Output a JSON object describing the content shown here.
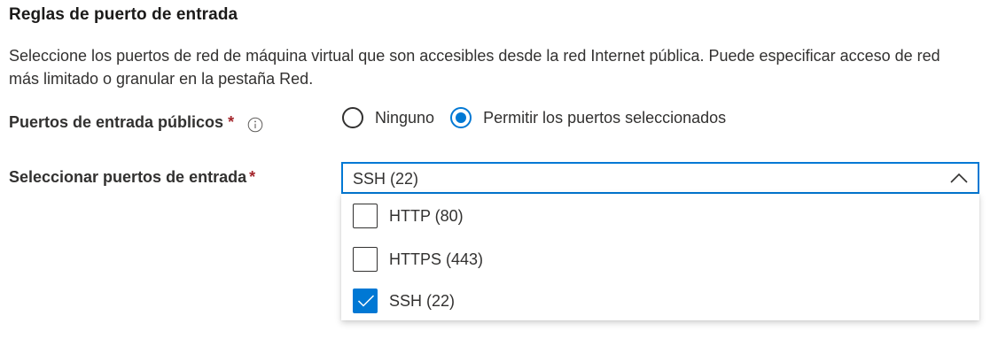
{
  "section": {
    "title": "Reglas de puerto de entrada",
    "description": "Seleccione los puertos de red de máquina virtual que son accesibles desde la red Internet pública. Puede especificar acceso de red más limitado o granular en la pestaña Red."
  },
  "public_ports": {
    "label": "Puertos de entrada públicos",
    "required_mark": "*",
    "info_icon": "info-icon",
    "options": [
      {
        "label": "Ninguno",
        "selected": false
      },
      {
        "label": "Permitir los puertos seleccionados",
        "selected": true
      }
    ]
  },
  "select_ports": {
    "label": "Seleccionar puertos de entrada",
    "required_mark": "*",
    "value": "SSH (22)",
    "expanded": true,
    "options": [
      {
        "label": "HTTP (80)",
        "checked": false
      },
      {
        "label": "HTTPS (443)",
        "checked": false
      },
      {
        "label": "SSH (22)",
        "checked": true
      }
    ]
  },
  "colors": {
    "accent": "#0078d4",
    "required": "#a4262c",
    "text": "#323130"
  }
}
